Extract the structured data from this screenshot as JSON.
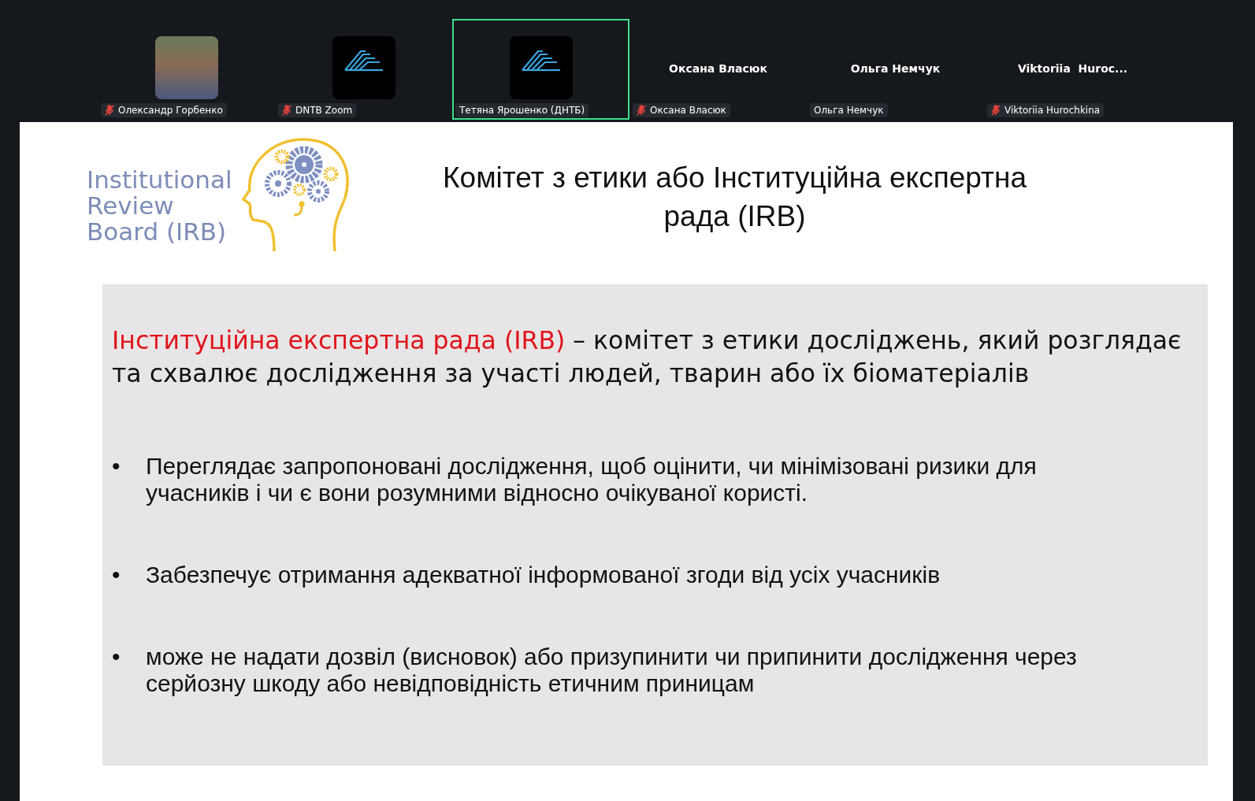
{
  "participants": [
    {
      "name": "Олександр Горбенко",
      "kind": "photo",
      "muted": true,
      "speaking": false
    },
    {
      "name": "DNTB Zoom",
      "kind": "logo",
      "muted": true,
      "speaking": false
    },
    {
      "name": "Тетяна Ярошенко (ДНТБ)",
      "kind": "logo",
      "muted": false,
      "speaking": true
    },
    {
      "name": "Оксана Власюк",
      "kind": "text",
      "tile_text": "Оксана Власюк",
      "muted": true,
      "speaking": false
    },
    {
      "name": "Ольга Немчук",
      "kind": "text",
      "tile_text": "Ольга Немчук",
      "muted": false,
      "speaking": false
    },
    {
      "name": "Viktoriia Hurochkina",
      "kind": "text",
      "tile_text": "Viktoriia  Huroc...",
      "muted": true,
      "speaking": false
    }
  ],
  "slide": {
    "logo_text": [
      "Institutional",
      "Review",
      "Board (IRB)"
    ],
    "title": "Комітет з етики або Інституційна експертна рада (IRB)",
    "definition_term": "Інституційна експертна рада (IRB)",
    "definition_text": " –  комітет з етики досліджень, який розглядає та схвалює дослідження за участі людей, тварин або їх біоматеріалів",
    "bullets": [
      {
        "marker": "•",
        "text": "Переглядає  запропоновані дослідження, щоб оцінити, чи мінімізовані ризики для учасників і чи є вони розумними відносно очікуваної користі."
      },
      {
        "marker": "•",
        "text": "Забезпечує  отримання адекватної інформованої згоди від усіх учасників"
      },
      {
        "marker": "•",
        "text": "може не надати дозвіл (висновок) або  призупинити чи  припинити дослідження через серйозну шкоду або невідповідність етичним приницам"
      }
    ]
  }
}
